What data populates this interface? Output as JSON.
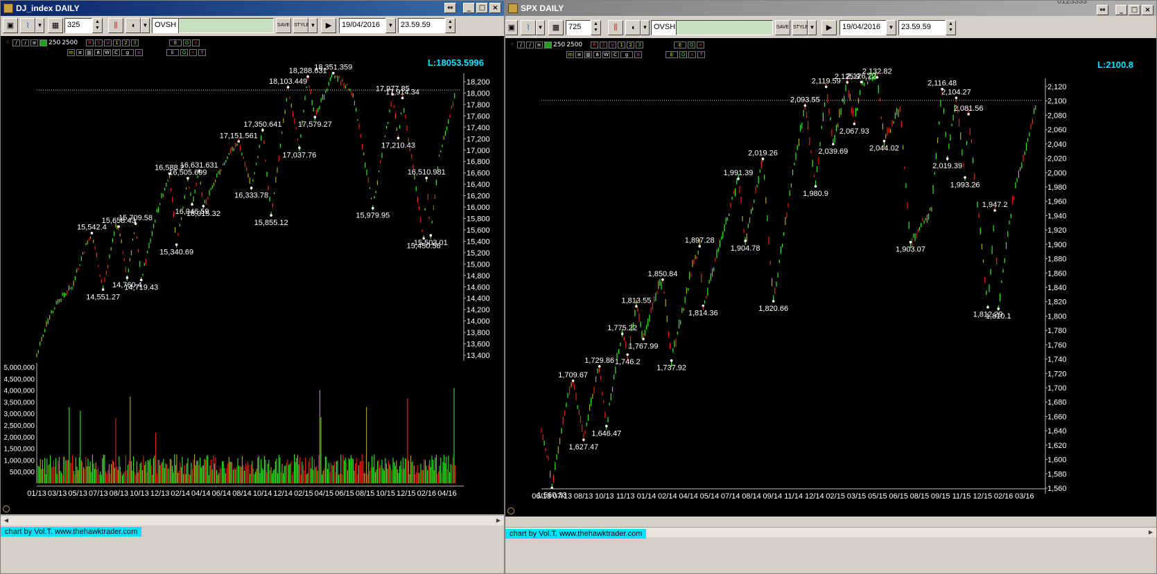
{
  "windows": [
    {
      "title": "DJ_index DAILY",
      "period": "325",
      "ticker": "OVSH",
      "date": "19/04/2016",
      "time": "23.59.59",
      "last_label": "L:18053.5996",
      "mini_counts": [
        "250",
        "2500"
      ],
      "footer": "chart by Vol.T. www.thehawktrader.com"
    },
    {
      "title": "SPX DAILY",
      "period": "725",
      "ticker": "OVSH",
      "date": "19/04/2016",
      "time": "23.59.59",
      "last_label": "L:2100.8",
      "mini_counts": [
        "250",
        "2500"
      ],
      "footer": "chart by Vol.T. www.thehawktrader.com"
    }
  ],
  "top_right_text": "0123333",
  "icons": [
    "save-icon",
    "chart-icon",
    "grid-icon",
    "bar-chart-icon",
    "sound-icon",
    "save-text-icon",
    "style-icon",
    "play-icon"
  ],
  "colors": {
    "background": "#000000",
    "up": "#33ee22",
    "down": "#ee2211",
    "neutral": "#b8a820",
    "label": "#ffffff",
    "last": "#00e5ff",
    "title_active": "#0a246a",
    "title_inactive": "#808080"
  },
  "chart_data": [
    {
      "type": "bar",
      "title": "DJ_index DAILY",
      "y_ticks": [
        "18,200",
        "18,000",
        "17,800",
        "17,600",
        "17,400",
        "17,200",
        "17,000",
        "16,800",
        "16,600",
        "16,400",
        "16,200",
        "16,000",
        "15,800",
        "15,600",
        "15,400",
        "15,200",
        "15,000",
        "14,800",
        "14,600",
        "14,400",
        "14,200",
        "14,000",
        "13,800",
        "13,600",
        "13,400"
      ],
      "ylim": [
        13400,
        18200
      ],
      "x_ticks": [
        "01/13",
        "03/13",
        "05/13",
        "07/13",
        "08/13",
        "10/13",
        "12/13",
        "02/14",
        "04/14",
        "06/14",
        "08/14",
        "10/14",
        "12/14",
        "02/15",
        "04/15",
        "06/15",
        "08/15",
        "10/15",
        "12/15",
        "02/16",
        "04/16"
      ],
      "last_value": 18053.5996,
      "path": [
        [
          0,
          13400
        ],
        [
          0.8,
          14000
        ],
        [
          1.5,
          14350
        ],
        [
          2.5,
          14600
        ],
        [
          3.6,
          15400
        ],
        [
          3.9,
          15542.4
        ],
        [
          4.7,
          14551.27
        ],
        [
          5.6,
          15650
        ],
        [
          5.8,
          15658.43
        ],
        [
          6.4,
          14760.4
        ],
        [
          7.0,
          15709.58
        ],
        [
          7.4,
          14719.43
        ],
        [
          8.5,
          15900
        ],
        [
          9.4,
          16588.2
        ],
        [
          9.9,
          15340.69
        ],
        [
          10.7,
          16505.699
        ],
        [
          11.0,
          16046.59
        ],
        [
          11.5,
          16631.631
        ],
        [
          11.8,
          16015.32
        ],
        [
          13.5,
          16900
        ],
        [
          14.3,
          17151.561
        ],
        [
          15.2,
          16333.78
        ],
        [
          16.0,
          17350.641
        ],
        [
          16.6,
          15855.12
        ],
        [
          17.8,
          18103.449
        ],
        [
          18.6,
          17037.76
        ],
        [
          19.2,
          18288.631
        ],
        [
          19.7,
          17579.27
        ],
        [
          21.0,
          18351.359
        ],
        [
          22.4,
          18000
        ],
        [
          23.8,
          15979.95
        ],
        [
          25.2,
          17977.85
        ],
        [
          25.6,
          17210.43
        ],
        [
          25.9,
          17914.34
        ],
        [
          27.4,
          15450.56
        ],
        [
          27.6,
          16510.981
        ],
        [
          27.9,
          15503.01
        ],
        [
          28.5,
          16900
        ],
        [
          29.7,
          18053.6
        ]
      ],
      "labels": [
        {
          "text": "15,542.4",
          "x": 3.9,
          "y": 15542.4,
          "pos": "above"
        },
        {
          "text": "14,551.27",
          "x": 4.7,
          "y": 14551.27,
          "pos": "below"
        },
        {
          "text": "15,658.43",
          "x": 5.8,
          "y": 15658.43,
          "pos": "above"
        },
        {
          "text": "14,760.4",
          "x": 6.4,
          "y": 14760.4,
          "pos": "below"
        },
        {
          "text": "15,709.58",
          "x": 7.0,
          "y": 15709.58,
          "pos": "above"
        },
        {
          "text": "14,719.43",
          "x": 7.4,
          "y": 14719.43,
          "pos": "below"
        },
        {
          "text": "16,588.2",
          "x": 9.4,
          "y": 16588.2,
          "pos": "above"
        },
        {
          "text": "15,340.69",
          "x": 9.9,
          "y": 15340.69,
          "pos": "below"
        },
        {
          "text": "16,505.699",
          "x": 10.7,
          "y": 16505.699,
          "pos": "above"
        },
        {
          "text": "16,046.59",
          "x": 11.0,
          "y": 16046.59,
          "pos": "below"
        },
        {
          "text": "16,631.631",
          "x": 11.5,
          "y": 16631.631,
          "pos": "above"
        },
        {
          "text": "16,015.32",
          "x": 11.8,
          "y": 16015.32,
          "pos": "below"
        },
        {
          "text": "17,151.561",
          "x": 14.3,
          "y": 17151.561,
          "pos": "above"
        },
        {
          "text": "16,333.78",
          "x": 15.2,
          "y": 16333.78,
          "pos": "below"
        },
        {
          "text": "17,350.641",
          "x": 16.0,
          "y": 17350.641,
          "pos": "above"
        },
        {
          "text": "15,855.12",
          "x": 16.6,
          "y": 15855.12,
          "pos": "below"
        },
        {
          "text": "18,103.449",
          "x": 17.8,
          "y": 18103.449,
          "pos": "above"
        },
        {
          "text": "17,037.76",
          "x": 18.6,
          "y": 17037.76,
          "pos": "below"
        },
        {
          "text": "18,288.631",
          "x": 19.2,
          "y": 18288.631,
          "pos": "above"
        },
        {
          "text": "17,579.27",
          "x": 19.7,
          "y": 17579.27,
          "pos": "below"
        },
        {
          "text": "18,351.359",
          "x": 21.0,
          "y": 18351.359,
          "pos": "above"
        },
        {
          "text": "15,979.95",
          "x": 23.8,
          "y": 15979.95,
          "pos": "below"
        },
        {
          "text": "17,977.85",
          "x": 25.2,
          "y": 17977.85,
          "pos": "above"
        },
        {
          "text": "17,210.43",
          "x": 25.6,
          "y": 17210.43,
          "pos": "below"
        },
        {
          "text": "17,914.34",
          "x": 25.9,
          "y": 17914.34,
          "pos": "above"
        },
        {
          "text": "15,450.56",
          "x": 27.4,
          "y": 15450.56,
          "pos": "below"
        },
        {
          "text": "16,510.981",
          "x": 27.6,
          "y": 16510.981,
          "pos": "above"
        },
        {
          "text": "15,503.01",
          "x": 27.9,
          "y": 15503.01,
          "pos": "below"
        }
      ],
      "volume": {
        "y_ticks": [
          "5,000,000",
          "4,500,000",
          "4,000,000",
          "3,500,000",
          "3,000,000",
          "2,500,000",
          "2,000,000",
          "1,500,000",
          "1,000,000",
          "500,000"
        ],
        "ylim": [
          0,
          5000000
        ]
      }
    },
    {
      "type": "bar",
      "title": "SPX DAILY",
      "y_ticks": [
        "2,120",
        "2,100",
        "2,080",
        "2,060",
        "2,040",
        "2,020",
        "2,000",
        "1,980",
        "1,960",
        "1,940",
        "1,920",
        "1,900",
        "1,880",
        "1,860",
        "1,840",
        "1,820",
        "1,800",
        "1,780",
        "1,760",
        "1,740",
        "1,720",
        "1,700",
        "1,680",
        "1,660",
        "1,640",
        "1,620",
        "1,600",
        "1,580",
        "1,560"
      ],
      "ylim": [
        1560,
        2120
      ],
      "x_ticks": [
        "06/13",
        "07/13",
        "08/13",
        "10/13",
        "11/13",
        "01/14",
        "02/14",
        "04/14",
        "05/14",
        "07/14",
        "08/14",
        "09/14",
        "11/14",
        "12/14",
        "02/15",
        "03/15",
        "05/15",
        "06/15",
        "08/15",
        "09/15",
        "11/15",
        "12/15",
        "02/16",
        "03/16"
      ],
      "last_value": 2100.8,
      "path": [
        [
          0,
          1640
        ],
        [
          0.4,
          1600
        ],
        [
          0.6,
          1560.33
        ],
        [
          1.5,
          1690
        ],
        [
          1.8,
          1709.67
        ],
        [
          2.4,
          1627.47
        ],
        [
          3.0,
          1700
        ],
        [
          3.3,
          1729.86
        ],
        [
          3.7,
          1646.47
        ],
        [
          4.3,
          1740
        ],
        [
          4.6,
          1775.22
        ],
        [
          4.9,
          1746.2
        ],
        [
          5.4,
          1813.55
        ],
        [
          5.8,
          1767.99
        ],
        [
          6.5,
          1830
        ],
        [
          6.9,
          1850.84
        ],
        [
          7.4,
          1737.92
        ],
        [
          8.6,
          1870
        ],
        [
          9.0,
          1897.28
        ],
        [
          9.2,
          1814.36
        ],
        [
          10.5,
          1930
        ],
        [
          11.2,
          1991.39
        ],
        [
          11.6,
          1904.78
        ],
        [
          12.6,
          2019.26
        ],
        [
          13.2,
          1820.66
        ],
        [
          14.3,
          2000
        ],
        [
          15.0,
          2093.55
        ],
        [
          15.6,
          1980.9
        ],
        [
          16.2,
          2119.59
        ],
        [
          16.6,
          2039.69
        ],
        [
          17.4,
          2125
        ],
        [
          17.8,
          2067.93
        ],
        [
          18.2,
          2126.22
        ],
        [
          19.1,
          2132.82
        ],
        [
          19.5,
          2044.02
        ],
        [
          20.4,
          2090
        ],
        [
          21.0,
          1903.07
        ],
        [
          22.2,
          1950
        ],
        [
          22.8,
          2116.48
        ],
        [
          23.1,
          2019.39
        ],
        [
          23.6,
          2104.27
        ],
        [
          24.1,
          1993.26
        ],
        [
          24.3,
          2081.56
        ],
        [
          25.4,
          1812.29
        ],
        [
          25.8,
          1947.2
        ],
        [
          26.0,
          1810.1
        ],
        [
          26.8,
          1960
        ],
        [
          28.2,
          2100.8
        ]
      ],
      "labels": [
        {
          "text": "1,560.33",
          "x": 0.6,
          "y": 1560.33,
          "pos": "below"
        },
        {
          "text": "1,709.67",
          "x": 1.8,
          "y": 1709.67,
          "pos": "above"
        },
        {
          "text": "1,627.47",
          "x": 2.4,
          "y": 1627.47,
          "pos": "below"
        },
        {
          "text": "1,729.86",
          "x": 3.3,
          "y": 1729.86,
          "pos": "above"
        },
        {
          "text": "1,646.47",
          "x": 3.7,
          "y": 1646.47,
          "pos": "below"
        },
        {
          "text": "1,775.22",
          "x": 4.6,
          "y": 1775.22,
          "pos": "above"
        },
        {
          "text": "1,746.2",
          "x": 4.9,
          "y": 1746.2,
          "pos": "below"
        },
        {
          "text": "1,813.55",
          "x": 5.4,
          "y": 1813.55,
          "pos": "above"
        },
        {
          "text": "1,767.99",
          "x": 5.8,
          "y": 1767.99,
          "pos": "below"
        },
        {
          "text": "1,850.84",
          "x": 6.9,
          "y": 1850.84,
          "pos": "above"
        },
        {
          "text": "1,737.92",
          "x": 7.4,
          "y": 1737.92,
          "pos": "below"
        },
        {
          "text": "1,897.28",
          "x": 9.0,
          "y": 1897.28,
          "pos": "above"
        },
        {
          "text": "1,814.36",
          "x": 9.2,
          "y": 1814.36,
          "pos": "below"
        },
        {
          "text": "1,991.39",
          "x": 11.2,
          "y": 1991.39,
          "pos": "above"
        },
        {
          "text": "1,904.78",
          "x": 11.6,
          "y": 1904.78,
          "pos": "below"
        },
        {
          "text": "2,019.26",
          "x": 12.6,
          "y": 2019.26,
          "pos": "above"
        },
        {
          "text": "1,820.66",
          "x": 13.2,
          "y": 1820.66,
          "pos": "below"
        },
        {
          "text": "2,093.55",
          "x": 15.0,
          "y": 2093.55,
          "pos": "above"
        },
        {
          "text": "1,980.9",
          "x": 15.6,
          "y": 1980.9,
          "pos": "below"
        },
        {
          "text": "2,119.59",
          "x": 16.2,
          "y": 2119.59,
          "pos": "above"
        },
        {
          "text": "2,039.69",
          "x": 16.6,
          "y": 2039.69,
          "pos": "below"
        },
        {
          "text": "2,125.9",
          "x": 17.4,
          "y": 2125.9,
          "pos": "above"
        },
        {
          "text": "2,067.93",
          "x": 17.8,
          "y": 2067.93,
          "pos": "below"
        },
        {
          "text": "2,126.22",
          "x": 18.2,
          "y": 2126.22,
          "pos": "above"
        },
        {
          "text": "2,132.82",
          "x": 19.1,
          "y": 2132.82,
          "pos": "above"
        },
        {
          "text": "2,044.02",
          "x": 19.5,
          "y": 2044.02,
          "pos": "below"
        },
        {
          "text": "1,903.07",
          "x": 21.0,
          "y": 1903.07,
          "pos": "below"
        },
        {
          "text": "2,116.48",
          "x": 22.8,
          "y": 2116.48,
          "pos": "above"
        },
        {
          "text": "2,019.39",
          "x": 23.1,
          "y": 2019.39,
          "pos": "below"
        },
        {
          "text": "2,104.27",
          "x": 23.6,
          "y": 2104.27,
          "pos": "above"
        },
        {
          "text": "1,993.26",
          "x": 24.1,
          "y": 1993.26,
          "pos": "below"
        },
        {
          "text": "2,081.56",
          "x": 24.3,
          "y": 2081.56,
          "pos": "above"
        },
        {
          "text": "1,812.29",
          "x": 25.4,
          "y": 1812.29,
          "pos": "below"
        },
        {
          "text": "1,947.2",
          "x": 25.8,
          "y": 1947.2,
          "pos": "above"
        },
        {
          "text": "1,810.1",
          "x": 26.0,
          "y": 1810.1,
          "pos": "below"
        }
      ]
    }
  ]
}
